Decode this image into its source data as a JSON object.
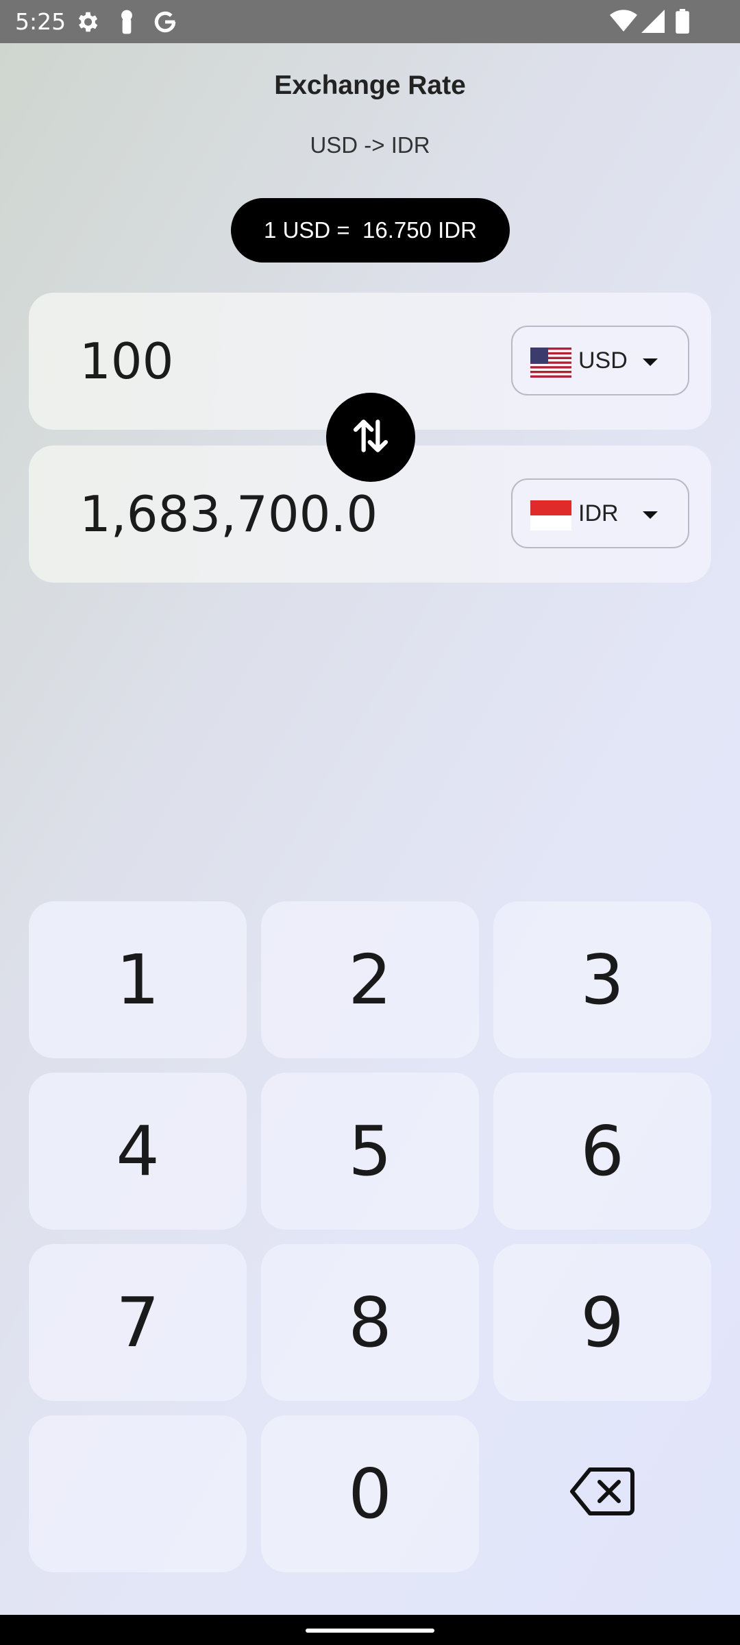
{
  "status": {
    "time": "5:25"
  },
  "header": {
    "title": "Exchange Rate",
    "subtitle": "USD -> IDR",
    "rate": "1 USD =  16.750 IDR"
  },
  "from": {
    "value": "100",
    "currency": "USD",
    "flag": "us-flag-icon"
  },
  "to": {
    "value": "1,683,700.0",
    "currency": "IDR",
    "flag": "indonesia-flag-icon"
  },
  "keypad": {
    "k1": "1",
    "k2": "2",
    "k3": "3",
    "k4": "4",
    "k5": "5",
    "k6": "6",
    "k7": "7",
    "k8": "8",
    "k9": "9",
    "k0": "0"
  },
  "icons": {
    "swap": "swap-vertical-icon",
    "backspace": "backspace-icon"
  },
  "colors": {
    "accent": "#000000",
    "key_background": "#eef0fc",
    "status_bar": "#737373"
  }
}
